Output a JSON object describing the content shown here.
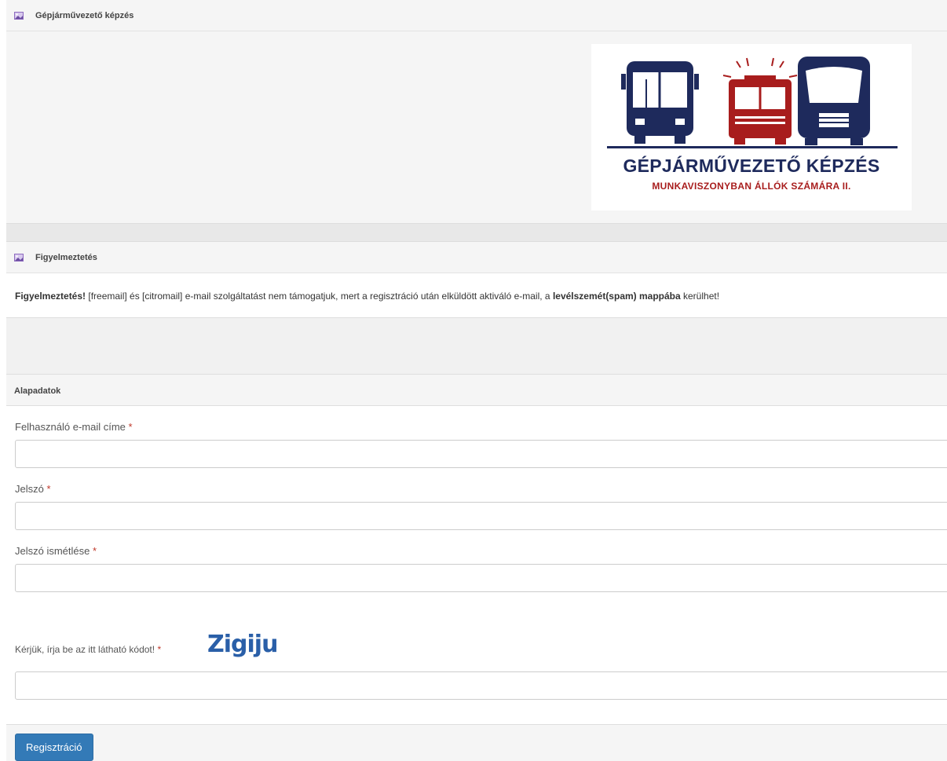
{
  "banner": {
    "title": "Gépjárművezető képzés"
  },
  "logo": {
    "line1": "GÉPJÁRMŰVEZETŐ KÉPZÉS",
    "line2": "MUNKAVISZONYBAN ÁLLÓK SZÁMÁRA II.",
    "colors": {
      "navy": "#1e2a5c",
      "red": "#a81d1d"
    }
  },
  "warning": {
    "title": "Figyelmeztetés",
    "bold_lead": "Figyelmeztetés!",
    "text_1": " [freemail] és [citromail] e-mail szolgáltatást nem támogatjuk, mert a regisztráció után elküldött aktiváló e-mail, a ",
    "bold_mid": "levélszemét(spam) mappába",
    "text_2": " kerülhet!"
  },
  "form": {
    "section_title": "Alapadatok",
    "email_label": "Felhasználó e-mail címe",
    "password_label": "Jelszó",
    "password_repeat_label": "Jelszó ismétlése",
    "captcha_label": "Kérjük, írja be az itt látható kódot!",
    "captcha_code": "Zigiju",
    "required_mark": "*",
    "email_value": "",
    "password_value": "",
    "password_repeat_value": "",
    "captcha_value": "",
    "submit_label": "Regisztráció"
  },
  "colors": {
    "primary_button": "#337ab7",
    "required": "#c0392b",
    "icon": "#8e6bbf"
  }
}
